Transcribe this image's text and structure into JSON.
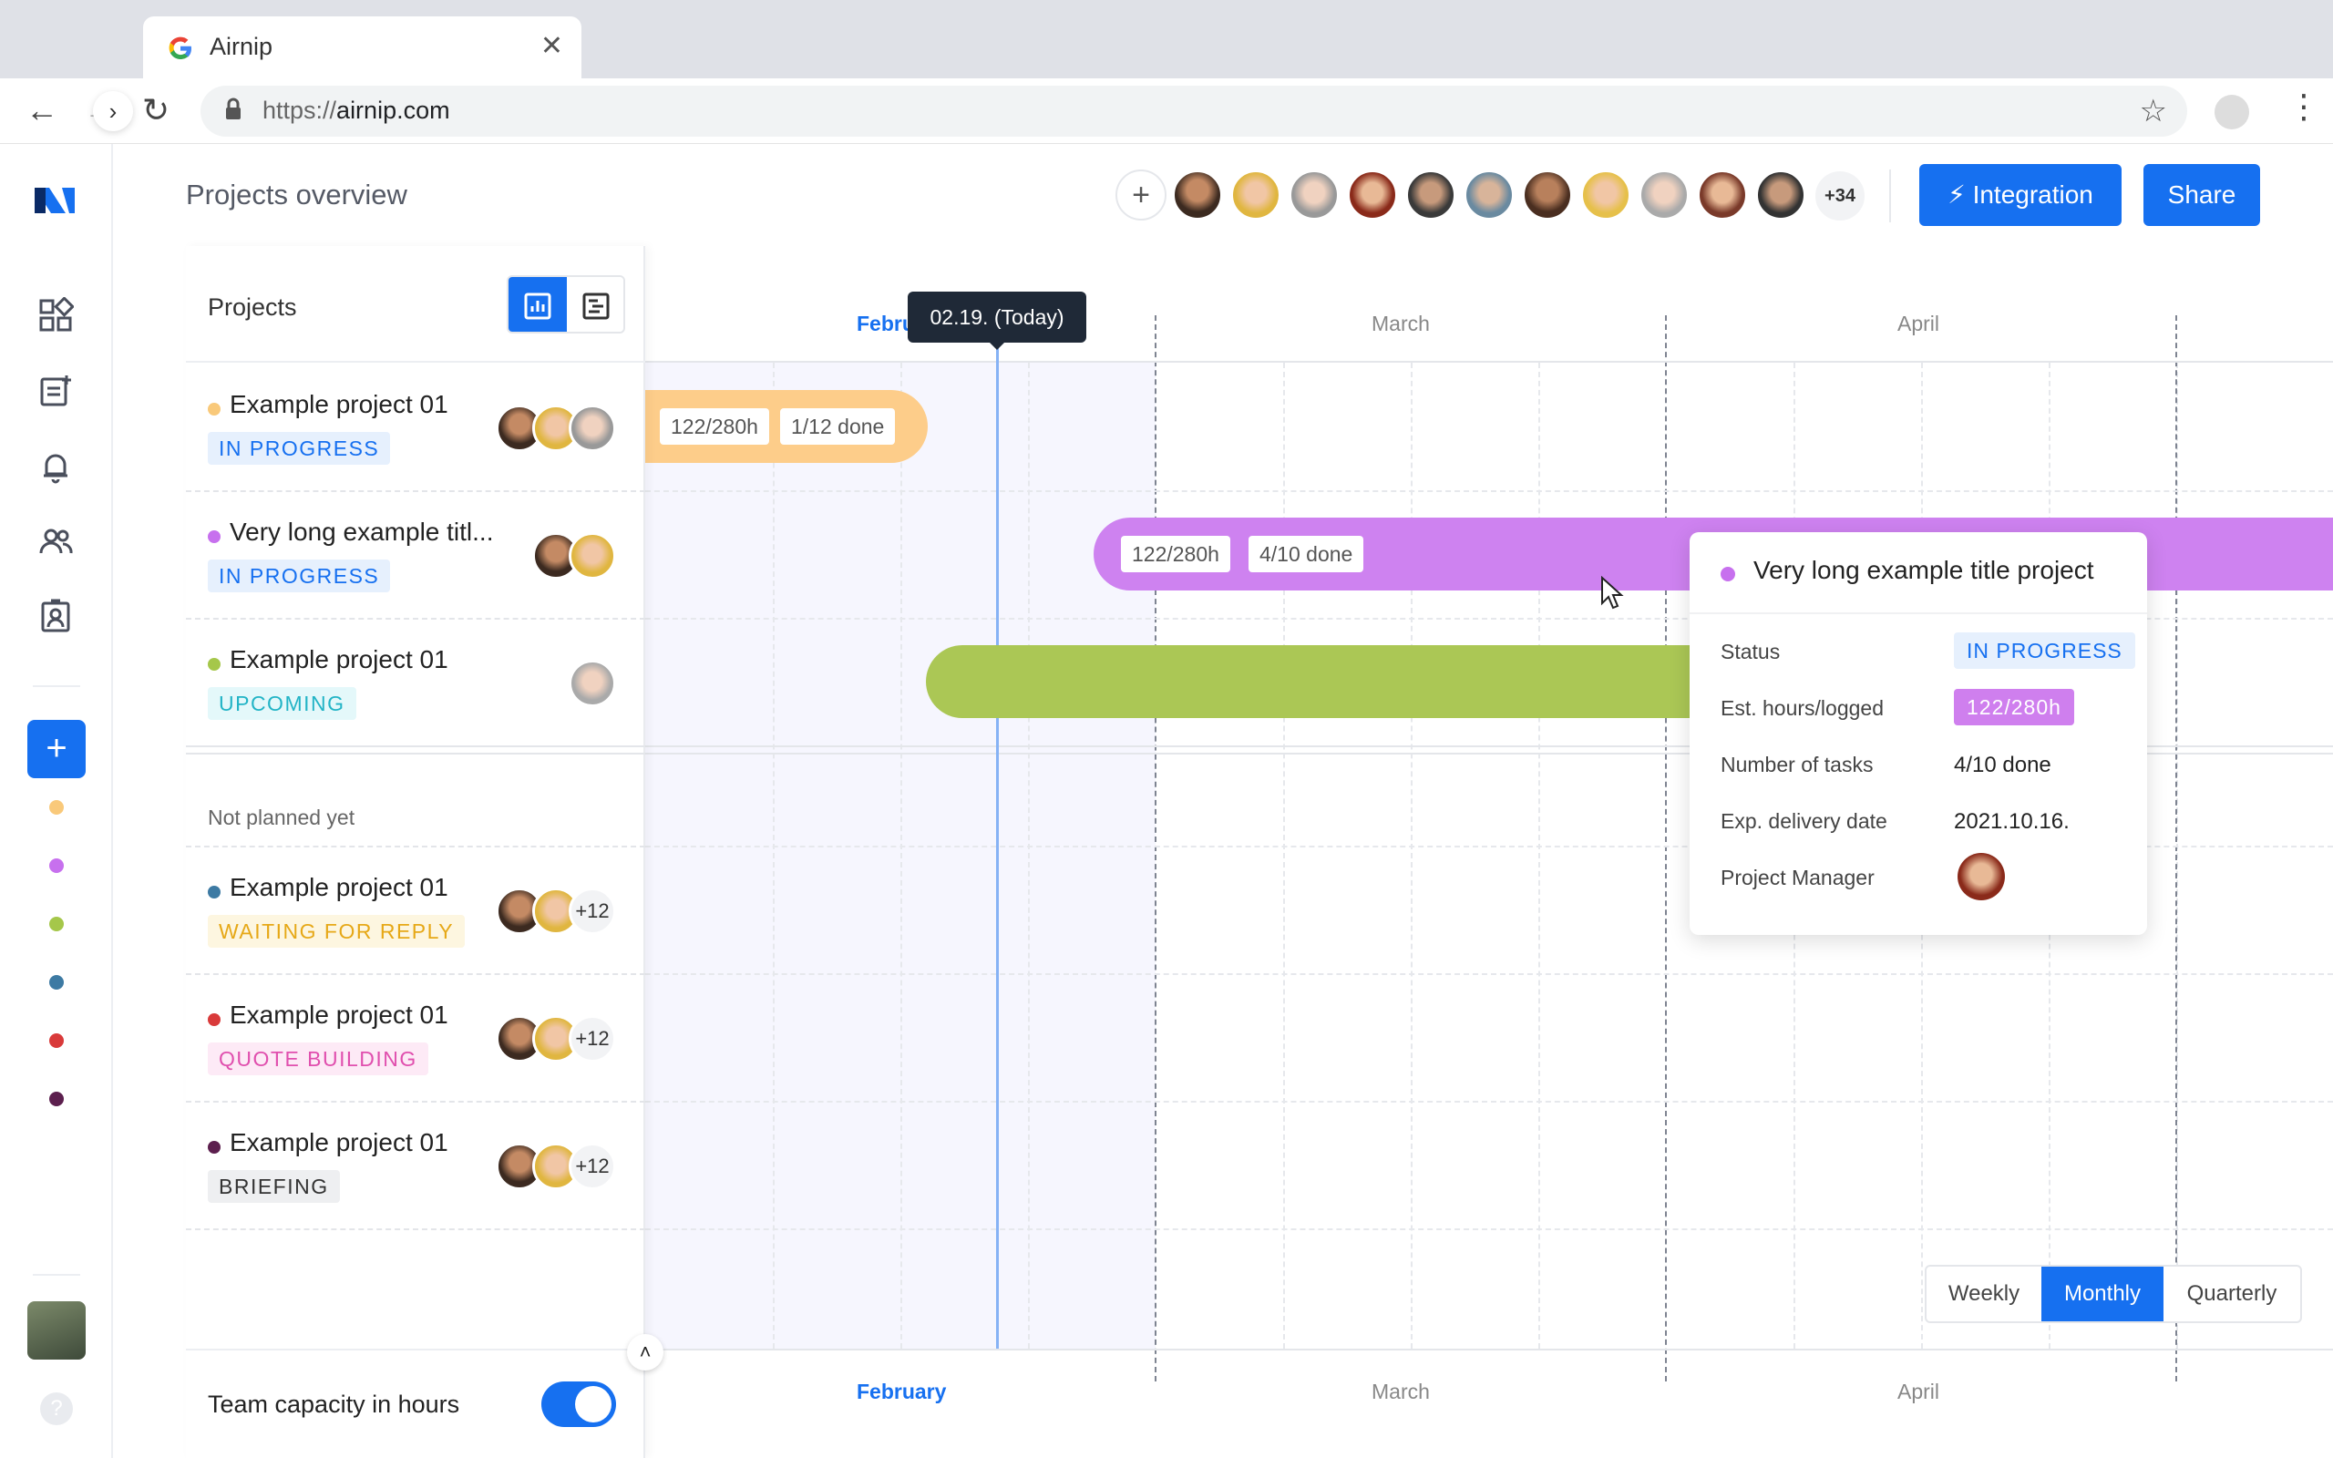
{
  "browser": {
    "tab_title": "Airnip",
    "tab_icon": "google-icon",
    "url_prefix": "https://",
    "url_host": "airnip.com"
  },
  "header": {
    "page_title": "Projects overview",
    "more_members": "+34",
    "integration_label": "Integration",
    "share_label": "Share",
    "accent_color": "#1670f0"
  },
  "panel": {
    "title": "Projects",
    "planned": [
      {
        "name": "Example project 01",
        "status": "IN PROGRESS",
        "dot": "#f9c97a"
      },
      {
        "name": "Very long example titl...",
        "status": "IN PROGRESS",
        "dot": "#c770ee"
      },
      {
        "name": "Example project 01",
        "status": "UPCOMING",
        "dot": "#a5c74a"
      }
    ],
    "not_planned_label": "Not planned yet",
    "unplanned": [
      {
        "name": "Example project 01",
        "status": "WAITING FOR REPLY",
        "dot": "#3d7aa3",
        "more": "+12"
      },
      {
        "name": "Example project 01",
        "status": "QUOTE BUILDING",
        "dot": "#d93a3a",
        "more": "+12"
      },
      {
        "name": "Example project 01",
        "status": "BRIEFING",
        "dot": "#5c1f4e",
        "more": "+12"
      }
    ],
    "capacity_label": "Team capacity in hours",
    "capacity_enabled": true
  },
  "timeline": {
    "months_top": [
      "Febru",
      "March",
      "April"
    ],
    "months_bottom": [
      "February",
      "March",
      "April"
    ],
    "today_label": "02.19. (Today)",
    "bars": [
      {
        "color": "#fdcd8a",
        "chips": [
          "122/280h",
          "1/12 done"
        ]
      },
      {
        "color": "#ce82f0",
        "chips": [
          "122/280h",
          "4/10 done"
        ]
      },
      {
        "color": "#abc755",
        "chips": []
      }
    ]
  },
  "popup": {
    "title": "Very long example title project",
    "rows": [
      {
        "label": "Status",
        "value": "IN PROGRESS"
      },
      {
        "label": "Est. hours/logged",
        "value": "122/280h"
      },
      {
        "label": "Number of tasks",
        "value": "4/10 done"
      },
      {
        "label": "Exp. delivery date",
        "value": "2021.10.16."
      },
      {
        "label": "Project Manager",
        "value": ""
      }
    ]
  },
  "period": {
    "options": [
      "Weekly",
      "Monthly",
      "Quarterly"
    ],
    "selected": "Monthly"
  }
}
